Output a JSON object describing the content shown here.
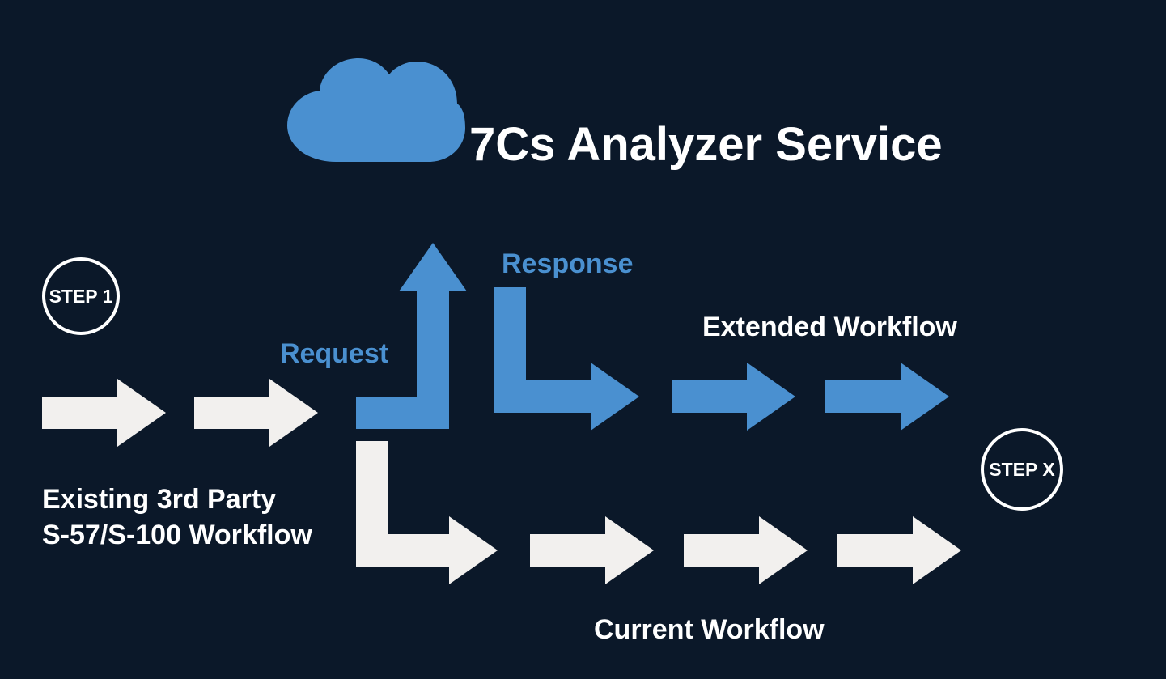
{
  "title": "7Cs Analyzer Service",
  "labels": {
    "step1": "STEP 1",
    "stepX": "STEP X",
    "request": "Request",
    "response": "Response",
    "extended": "Extended Workflow",
    "current": "Current Workflow",
    "existing_line1": "Existing 3rd Party",
    "existing_line2": "S-57/S-100 Workflow"
  },
  "colors": {
    "bg": "#0B1829",
    "blue": "#4A90D0",
    "white": "#F2F0EE"
  }
}
